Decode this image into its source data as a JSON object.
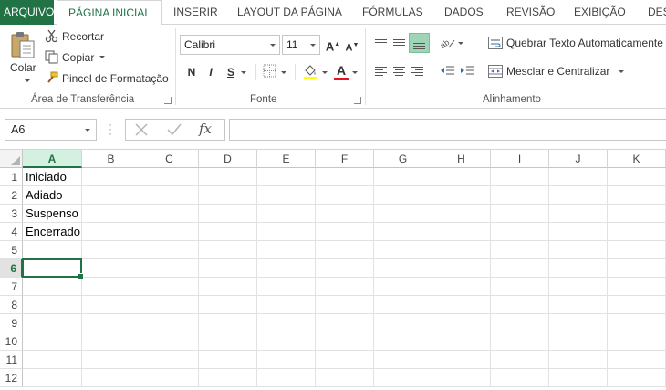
{
  "tabs": [
    "ARQUIVO",
    "PÁGINA INICIAL",
    "INSERIR",
    "LAYOUT DA PÁGINA",
    "FÓRMULAS",
    "DADOS",
    "REVISÃO",
    "EXIBIÇÃO",
    "DES"
  ],
  "clipboard": {
    "paste_label": "Colar",
    "cut_label": "Recortar",
    "copy_label": "Copiar",
    "format_painter_label": "Pincel de Formatação",
    "group_label": "Área de Transferência"
  },
  "font": {
    "name": "Calibri",
    "size": "11",
    "grow_label": "A",
    "shrink_label": "A",
    "bold": "N",
    "italic": "I",
    "underline": "S",
    "font_color_label": "A",
    "group_label": "Fonte",
    "font_color": "#e81123"
  },
  "alignment": {
    "wrap_text_label": "Quebrar Texto Automaticamente",
    "merge_label": "Mesclar e Centralizar",
    "group_label": "Alinhamento"
  },
  "formula_bar": {
    "name_box": "A6",
    "fx_label": "fx",
    "formula": ""
  },
  "sheet": {
    "columns": [
      "A",
      "B",
      "C",
      "D",
      "E",
      "F",
      "G",
      "H",
      "I",
      "J",
      "K"
    ],
    "rows": [
      "1",
      "2",
      "3",
      "4",
      "5",
      "6",
      "7",
      "8",
      "9",
      "10",
      "11",
      "12"
    ],
    "selected_column": "A",
    "selected_row": "6",
    "cells_A": [
      "Iniciado",
      "Adiado",
      "Suspenso",
      "Encerrado",
      "",
      "",
      "",
      "",
      "",
      "",
      "",
      ""
    ]
  },
  "accent_color": "#217346"
}
